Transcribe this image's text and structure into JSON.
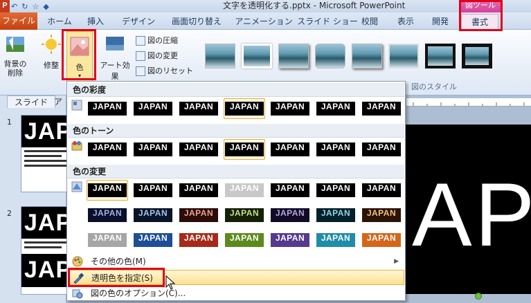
{
  "window": {
    "title": "文字を透明化する.pptx - Microsoft PowerPoint",
    "app_logo": "P",
    "context_group": "図ツール"
  },
  "quick_access": [
    "↶",
    "↻",
    "☆",
    "◆"
  ],
  "tabs": [
    {
      "label": "ファイル",
      "id": "file"
    },
    {
      "label": "ホーム"
    },
    {
      "label": "挿入"
    },
    {
      "label": "デザイン"
    },
    {
      "label": "画面切り替え"
    },
    {
      "label": "アニメーション"
    },
    {
      "label": "スライド ショー"
    },
    {
      "label": "校閲"
    },
    {
      "label": "表示"
    },
    {
      "label": "開発"
    },
    {
      "label": "書式",
      "active": true
    }
  ],
  "ribbon": {
    "remove_background": "背景の\n削除",
    "corrections": "修整",
    "color": "色",
    "artistic_effects": "アート効果",
    "compress": "図の圧縮",
    "change_picture": "図の変更",
    "reset_picture": "図のリセット",
    "styles_group": "図のスタイル"
  },
  "left_pane": {
    "tabs": [
      "スライド",
      "ア"
    ],
    "slides": [
      {
        "number": "1",
        "heading": "JAPA"
      },
      {
        "number": "2",
        "heading": "JAPA",
        "heading2": "JAP"
      }
    ]
  },
  "slide": {
    "text": "APA"
  },
  "dropdown": {
    "saturation": {
      "header": "色の彩度",
      "swatches": [
        {
          "text": "JAPAN",
          "bg": "#000000",
          "fg": "#ffffff"
        },
        {
          "text": "JAPAN",
          "bg": "#000000",
          "fg": "#ffffff"
        },
        {
          "text": "JAPAN",
          "bg": "#000000",
          "fg": "#ffffff"
        },
        {
          "text": "JAPAN",
          "bg": "#000000",
          "fg": "#ffffff",
          "selected": true
        },
        {
          "text": "JAPAN",
          "bg": "#000000",
          "fg": "#ffffff"
        },
        {
          "text": "JAPAN",
          "bg": "#000000",
          "fg": "#ffffff"
        },
        {
          "text": "JAPAN",
          "bg": "#000000",
          "fg": "#ffffff"
        }
      ]
    },
    "tone": {
      "header": "色のトーン",
      "swatches": [
        {
          "text": "JAPAN",
          "bg": "#000000",
          "fg": "#ffffff"
        },
        {
          "text": "JAPAN",
          "bg": "#000000",
          "fg": "#ffffff"
        },
        {
          "text": "JAPAN",
          "bg": "#000000",
          "fg": "#ffffff"
        },
        {
          "text": "JAPAN",
          "bg": "#000000",
          "fg": "#ffffff",
          "selected": true
        },
        {
          "text": "JAPAN",
          "bg": "#000000",
          "fg": "#ffffff"
        },
        {
          "text": "JAPAN",
          "bg": "#000000",
          "fg": "#ffffff"
        },
        {
          "text": "JAPAN",
          "bg": "#000000",
          "fg": "#ffffff"
        }
      ]
    },
    "recolor": {
      "header": "色の変更",
      "rows": [
        [
          {
            "text": "JAPAN",
            "bg": "#000000",
            "fg": "#ffffff",
            "selected": true
          },
          {
            "text": "JAPAN",
            "bg": "#000000",
            "fg": "#ffffff"
          },
          {
            "text": "JAPAN",
            "bg": "#000000",
            "fg": "#ffffff"
          },
          {
            "text": "JAPAN",
            "bg": "#c8c8c8",
            "fg": "#ffffff"
          },
          {
            "text": "JAPAN",
            "bg": "#000000",
            "fg": "#ffffff"
          },
          {
            "text": "JAPAN",
            "bg": "#000000",
            "fg": "#ffffff"
          },
          {
            "text": "JAPAN",
            "bg": "#000000",
            "fg": "#ffffff"
          }
        ],
        [
          {
            "text": "JAPAN",
            "bg": "#0a0f2a",
            "fg": "#9fb3e6"
          },
          {
            "text": "JAPAN",
            "bg": "#0a1428",
            "fg": "#9ec6ee"
          },
          {
            "text": "JAPAN",
            "bg": "#2a0c08",
            "fg": "#f0a08e"
          },
          {
            "text": "JAPAN",
            "bg": "#141f06",
            "fg": "#c9de8a"
          },
          {
            "text": "JAPAN",
            "bg": "#120b26",
            "fg": "#b3a4e0"
          },
          {
            "text": "JAPAN",
            "bg": "#04202a",
            "fg": "#8fd6e8"
          },
          {
            "text": "JAPAN",
            "bg": "#2a1404",
            "fg": "#f5bf80"
          }
        ],
        [
          {
            "text": "JAPAN",
            "bg": "#a6a6a6",
            "fg": "#ffffff"
          },
          {
            "text": "JAPAN",
            "bg": "#1f4e96",
            "fg": "#ffffff"
          },
          {
            "text": "JAPAN",
            "bg": "#a52a1a",
            "fg": "#ffffff"
          },
          {
            "text": "JAPAN",
            "bg": "#5d8a1e",
            "fg": "#ffffff"
          },
          {
            "text": "JAPAN",
            "bg": "#553a8e",
            "fg": "#ffffff"
          },
          {
            "text": "JAPAN",
            "bg": "#1f8ca8",
            "fg": "#ffffff"
          },
          {
            "text": "JAPAN",
            "bg": "#d4661a",
            "fg": "#ffffff"
          }
        ]
      ]
    },
    "more_colors": "その他の色(M)",
    "set_transparent": "透明色を指定(S)",
    "picture_color_options": "図の色のオプション(C)..."
  },
  "colors": {
    "callout": "#e0001b",
    "file_tab": "#c2410f",
    "highlight": "#fbe08e"
  }
}
